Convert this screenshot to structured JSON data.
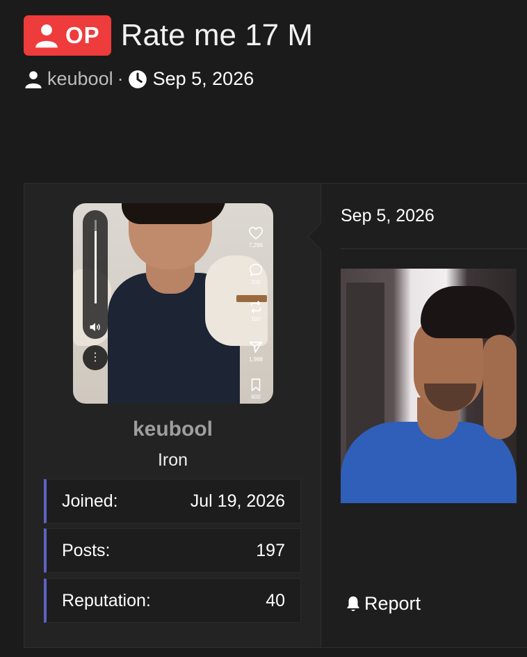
{
  "thread": {
    "badge_label": "OP",
    "title": "Rate me 17 M",
    "author": "keubool",
    "separator": "·",
    "date": "Sep 5, 2026"
  },
  "user": {
    "name": "keubool",
    "rank": "Iron",
    "stats": [
      {
        "label": "Joined:",
        "value": "Jul 19, 2026"
      },
      {
        "label": "Posts:",
        "value": "197"
      },
      {
        "label": "Reputation:",
        "value": "40"
      }
    ],
    "avatar_overlay": {
      "likes": "7,296",
      "comments": "200",
      "reposts": "100",
      "shares": "1,988",
      "saves": "600",
      "more_glyph": "⋮"
    }
  },
  "post": {
    "date": "Sep 5, 2026",
    "report_label": "Report"
  },
  "icons": {
    "op_badge": "user-icon",
    "author": "user-icon",
    "date": "clock-icon",
    "report": "bell-icon"
  },
  "colors": {
    "page_bg": "#1b1b1b",
    "op_badge_bg": "#ee3b3b",
    "stat_accent": "#5b63c4",
    "username": "#9e9e9e"
  }
}
